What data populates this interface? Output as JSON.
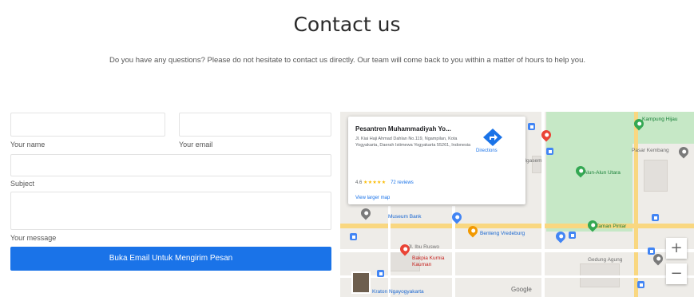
{
  "page": {
    "title": "Contact us",
    "subtitle": "Do you have any questions? Please do not hesitate to contact us directly. Our team will come back to you within a matter of hours to help you."
  },
  "form": {
    "name_label": "Your name",
    "name_value": "",
    "email_label": "Your email",
    "email_value": "",
    "subject_label": "Subject",
    "subject_value": "",
    "message_label": "Your message",
    "message_value": "",
    "submit_label": "Buka Email Untuk Mengirim Pesan"
  },
  "map": {
    "place_name": "Pesantren Muhammadiyah Yo...",
    "place_address": "Jl. Kiai Haji Ahmad Dahlan No.119, Ngampilan, Kota Yogyakarta, Daerah Istimewa Yogyakarta 55261, Indonesia",
    "rating": "4.6",
    "stars": "★★★★★",
    "reviews": "72 reviews",
    "view_larger": "View larger map",
    "directions_label": "Directions",
    "labels": {
      "tlabel1": "Kampung Hijau",
      "tlabel2": "Pasar Kembang",
      "tlabel3": "Alun-Alun Utara",
      "tlabel4": "Museum Bank",
      "tlabel5": "Taman Pintar",
      "tlabel6": "Benteng Vredeburg",
      "tlabel7": "Jl. Ibu Ruswo",
      "tlabel8": "Gedung Agung",
      "tlabel9": "Bakpia Kurnia",
      "tlabel10": "Kauman",
      "tlabel11": "Jl. Ngasem",
      "tlabel12": "Kraton Ngayogyakarta"
    },
    "google": "Google",
    "zoom_in": "+",
    "zoom_out": "−",
    "colors": {
      "accent": "#1a73e8",
      "park": "#c6e8c6",
      "pin_red": "#ea4335",
      "pin_green": "#34a853",
      "pin_orange": "#f29900"
    }
  }
}
